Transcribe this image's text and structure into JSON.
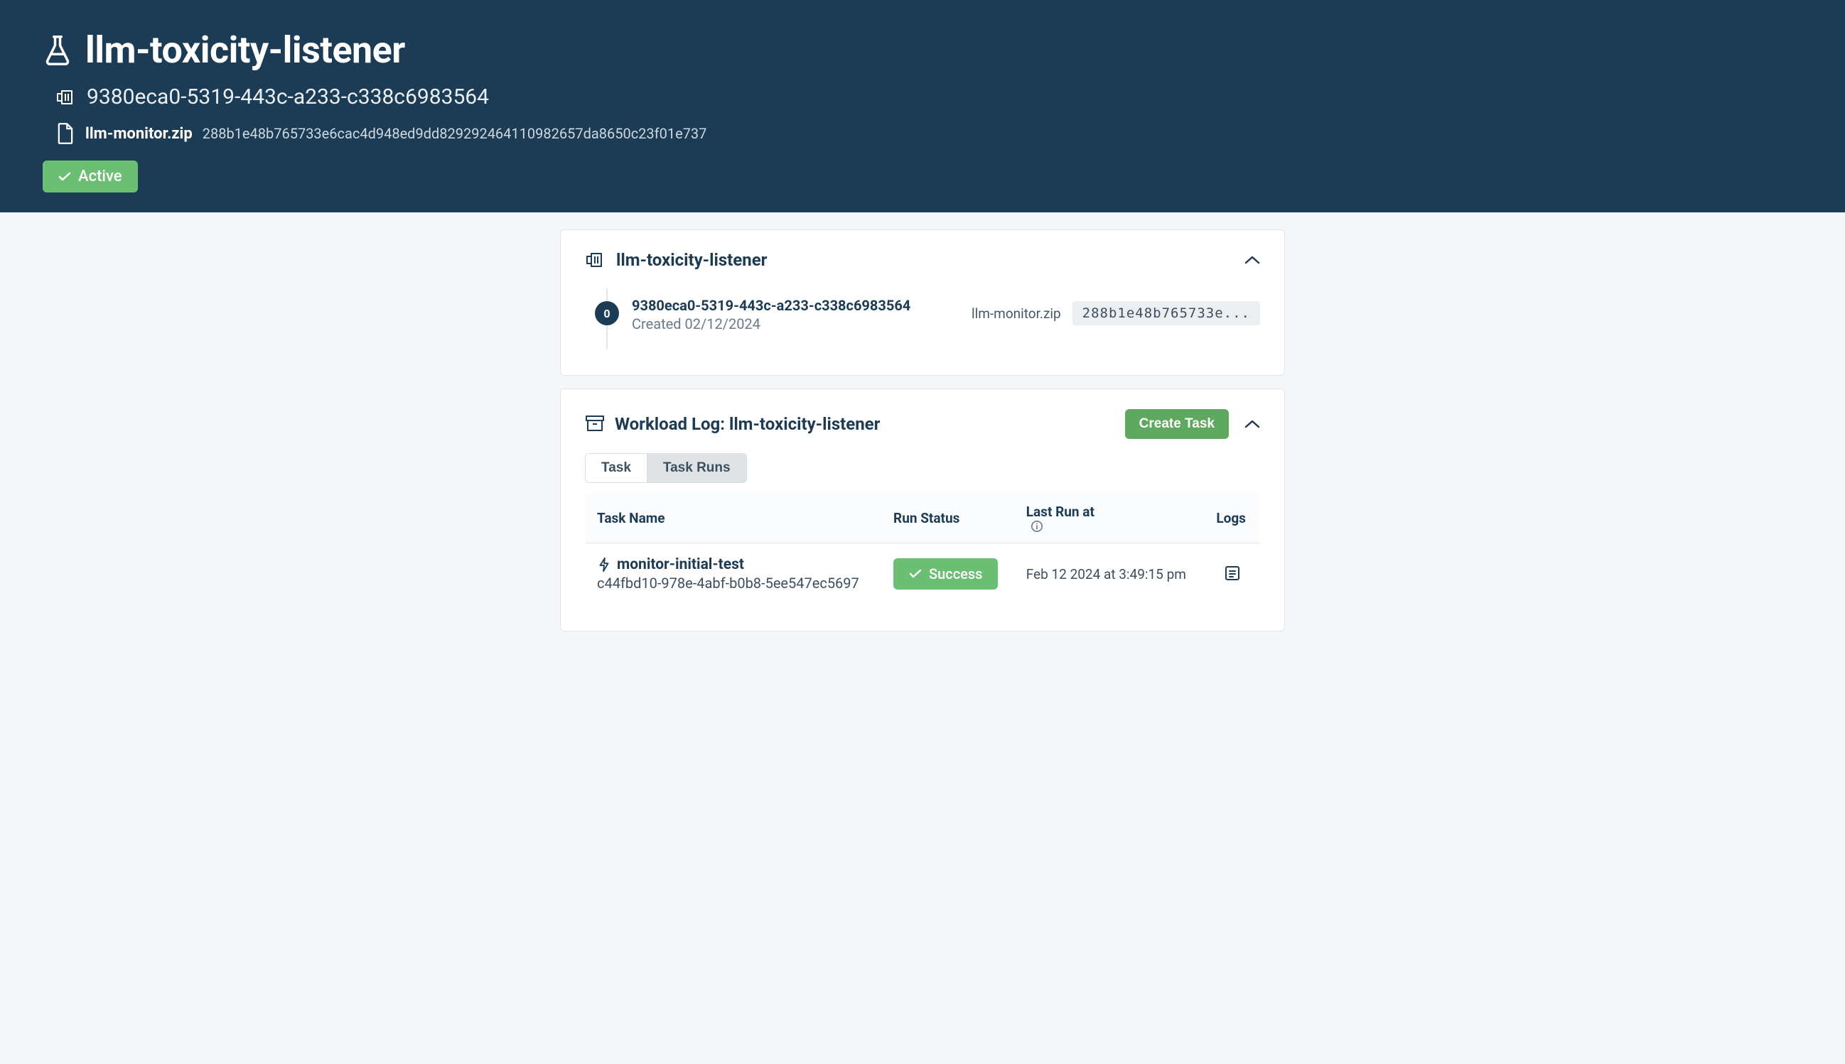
{
  "header": {
    "title": "llm-toxicity-listener",
    "resource_id": "9380eca0-5319-443c-a233-c338c6983564",
    "file_name": "llm-monitor.zip",
    "file_hash": "288b1e48b765733e6cac4d948ed9dd82929246411098​2657da8650c23f01e737",
    "status_label": "Active"
  },
  "version_card": {
    "title": "llm-toxicity-listener",
    "entry": {
      "index": "0",
      "id": "9380eca0-5319-443c-a233-c338c6983564",
      "created_label": "Created 02/12/2024",
      "zip_name": "llm-monitor.zip",
      "hash_truncated": "288b1e48b765733e..."
    }
  },
  "workload_log": {
    "title": "Workload Log: llm-toxicity-listener",
    "create_button": "Create Task",
    "tabs": {
      "task": "Task",
      "task_runs": "Task Runs"
    },
    "columns": {
      "task_name": "Task Name",
      "run_status": "Run Status",
      "last_run": "Last Run at",
      "logs": "Logs"
    },
    "rows": [
      {
        "task_name": "monitor-initial-test",
        "task_id": "c44fbd10-978e-4abf-b0b8-5ee547ec5697",
        "status_label": "Success",
        "last_run": "Feb 12 2024 at 3:49:15 pm"
      }
    ]
  }
}
